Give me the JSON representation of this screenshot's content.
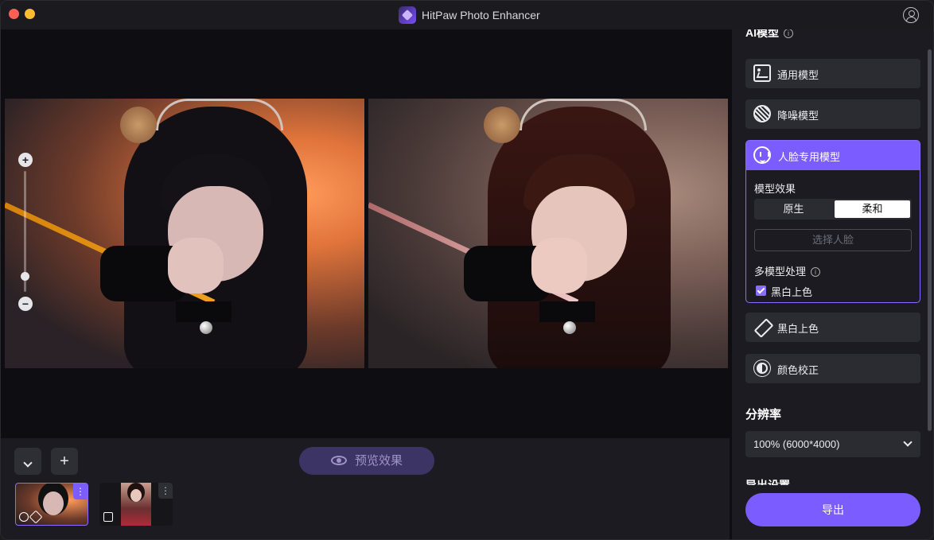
{
  "app": {
    "title": "HitPaw Photo Enhancer"
  },
  "toolbar": {
    "preview_label": "预览效果"
  },
  "thumbnails": [
    {
      "name": "thumb-1",
      "selected": true,
      "menu": "⋮"
    },
    {
      "name": "thumb-2",
      "selected": false,
      "menu": "⋮"
    }
  ],
  "panel": {
    "ai_model_title": "AI模型",
    "models": [
      {
        "label": "通用模型",
        "icon": "image-icon"
      },
      {
        "label": "降噪模型",
        "icon": "noise-icon"
      },
      {
        "label": "人脸专用模型",
        "icon": "face-icon",
        "active": true
      },
      {
        "label": "黑白上色",
        "icon": "brush-icon"
      },
      {
        "label": "颜色校正",
        "icon": "sun-icon"
      }
    ],
    "face_model": {
      "effect_label": "模型效果",
      "options": [
        "原生",
        "柔和"
      ],
      "selected_option": "柔和",
      "select_face_label": "选择人脸",
      "multi_model_label": "多模型处理",
      "bw_colorize_label": "黑白上色",
      "bw_colorize_checked": true
    },
    "resolution_title": "分辨率",
    "resolution_value": "100% (6000*4000)",
    "export_settings_title": "导出设置",
    "export_label": "导出"
  },
  "colors": {
    "accent": "#7b5cff",
    "background": "#0d0d12",
    "panel": "#1b1b21"
  }
}
